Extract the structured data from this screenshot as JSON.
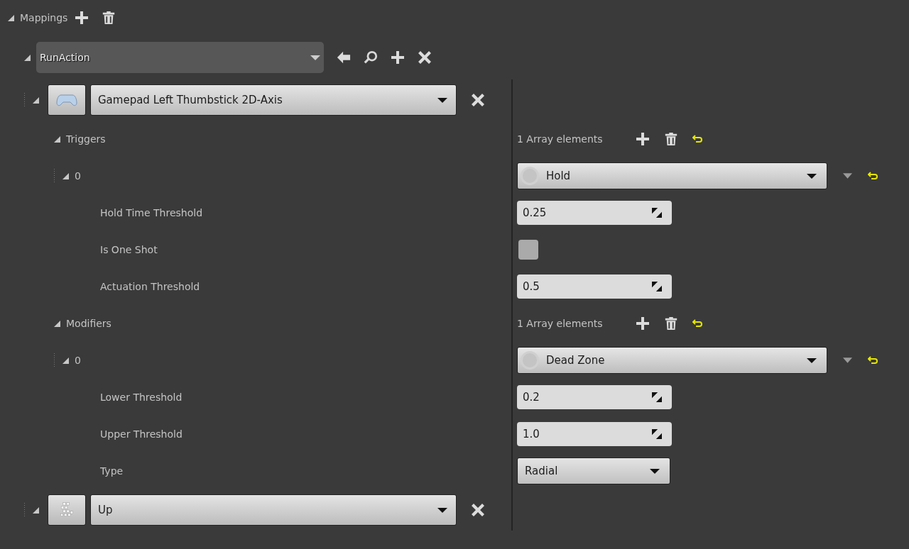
{
  "header": {
    "label": "Mappings",
    "expanded": true
  },
  "action": {
    "name": "RunAction",
    "expanded": true
  },
  "mappings": [
    {
      "kind": "gamepad",
      "key": "Gamepad Left Thumbstick 2D-Axis",
      "expanded": true,
      "sections": [
        {
          "label": "Triggers",
          "count": "1 Array elements",
          "expanded": true,
          "elements": [
            {
              "index": "0",
              "expanded": true,
              "class": "Hold",
              "properties": [
                {
                  "kind": "number",
                  "label": "Hold Time Threshold",
                  "value": "0.25"
                },
                {
                  "kind": "checkbox",
                  "label": "Is One Shot",
                  "checked": false
                },
                {
                  "kind": "number",
                  "label": "Actuation Threshold",
                  "value": "0.5"
                }
              ]
            }
          ]
        },
        {
          "label": "Modifiers",
          "count": "1 Array elements",
          "expanded": true,
          "elements": [
            {
              "index": "0",
              "expanded": true,
              "class": "Dead Zone",
              "properties": [
                {
                  "kind": "number",
                  "label": "Lower Threshold",
                  "value": "0.2"
                },
                {
                  "kind": "number",
                  "label": "Upper Threshold",
                  "value": "1.0"
                },
                {
                  "kind": "enum",
                  "label": "Type",
                  "value": "Radial"
                }
              ]
            }
          ]
        }
      ]
    },
    {
      "kind": "keyboard",
      "key": "Up",
      "expanded": true
    }
  ]
}
